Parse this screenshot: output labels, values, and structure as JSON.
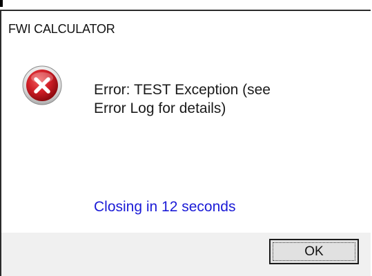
{
  "window": {
    "title": "FWI CALCULATOR"
  },
  "icon": {
    "name": "error-icon",
    "color": "#c8101c"
  },
  "message": {
    "text": "Error: TEST Exception (see\nError Log for details)"
  },
  "countdown": {
    "text": "Closing in 12 seconds",
    "color": "#1a1ad6"
  },
  "buttons": {
    "ok_label": "OK"
  }
}
